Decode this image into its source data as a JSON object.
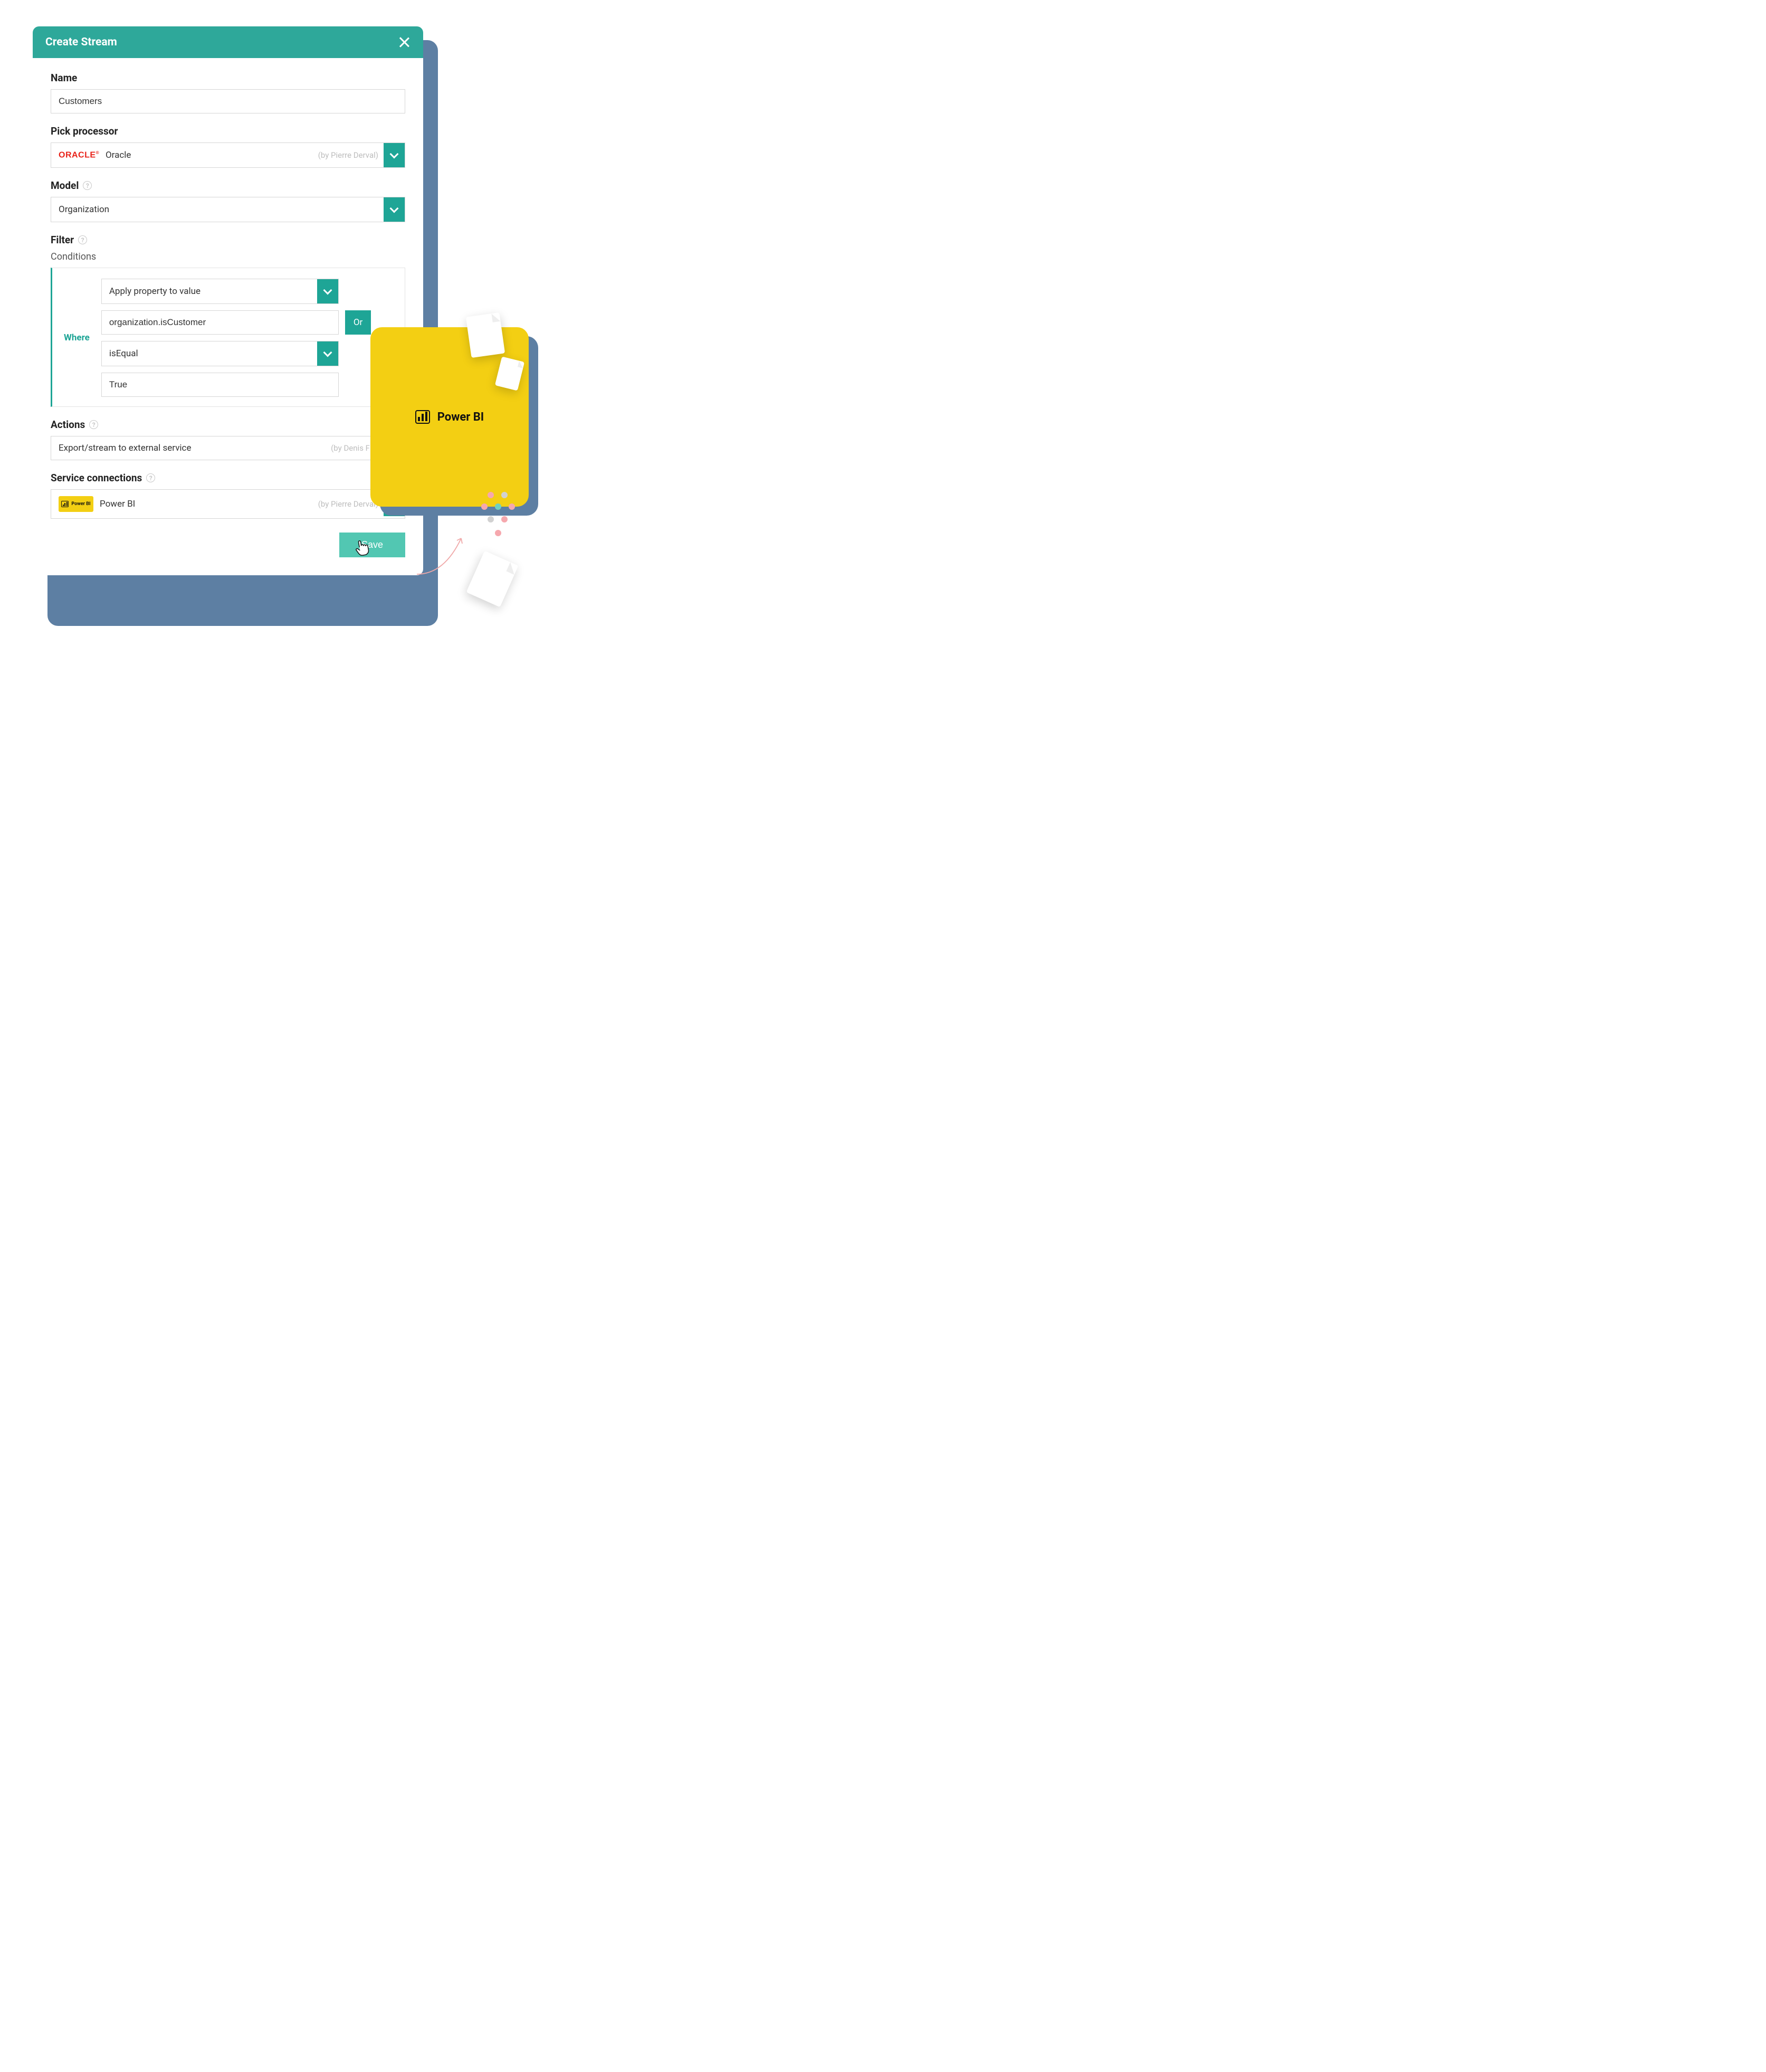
{
  "dialog": {
    "title": "Create Stream",
    "name_label": "Name",
    "name_value": "Customers",
    "processor_label": "Pick processor",
    "processor_value": "Oracle",
    "processor_logo_text": "ORACLE",
    "processor_by": "(by Pierre Derval)",
    "model_label": "Model",
    "model_value": "Organization",
    "filter_label": "Filter",
    "conditions_label": "Conditions",
    "where_label": "Where",
    "cond_type": "Apply property to value",
    "cond_property": "organization.isCustomer",
    "cond_op": "isEqual",
    "cond_value": "True",
    "or_label": "Or",
    "actions_label": "Actions",
    "actions_value": "Export/stream to external service",
    "actions_by": "(by Denis Florkin)",
    "service_label": "Service connections",
    "service_value": "Power BI",
    "service_badge": "Power BI",
    "service_by": "(by Pierre Derval)",
    "save_label": "Save"
  },
  "card": {
    "label": "Power BI"
  }
}
